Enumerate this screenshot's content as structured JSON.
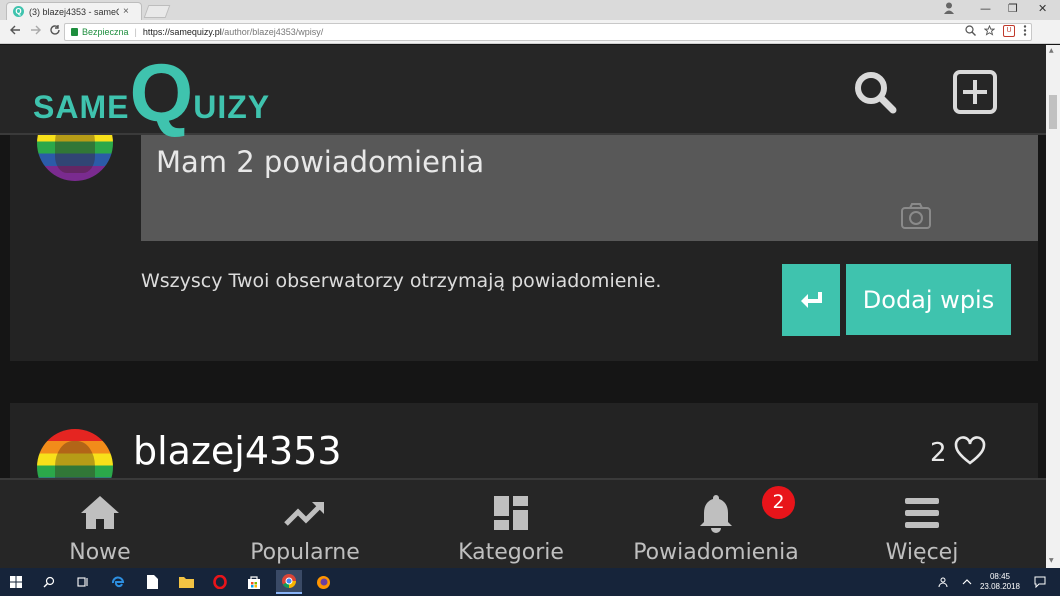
{
  "browser": {
    "tab_title": "(3) blazej4353 - sameQui",
    "tab_close": "×",
    "favicon_letter": "Q",
    "secure_label": "Bezpieczna",
    "url_host": "https://samequizy.pl",
    "url_path": "/author/blazej4353/wpisy/",
    "window_controls": [
      "—",
      "❐",
      "✕"
    ]
  },
  "header": {
    "logo_same": "same",
    "logo_q": "Q",
    "logo_uizy": "uizy",
    "search_icon": "search-icon",
    "add_icon": "plus-square-icon"
  },
  "compose": {
    "input_text": "Mam 2 powiadomienia",
    "notice": "Wszyscy Twoi obserwatorzy otrzymają powiadomienie.",
    "enter_icon": "enter-arrow-icon",
    "submit_label": "Dodaj wpis"
  },
  "post": {
    "author": "blazej4353",
    "likes": "2"
  },
  "bottom_nav": [
    {
      "label": "Nowe",
      "icon": "home-icon"
    },
    {
      "label": "Popularne",
      "icon": "trending-icon"
    },
    {
      "label": "Kategorie",
      "icon": "grid-icon"
    },
    {
      "label": "Powiadomienia",
      "icon": "bell-icon",
      "badge": "2"
    },
    {
      "label": "Więcej",
      "icon": "menu-icon"
    }
  ],
  "taskbar": {
    "time": "08:45",
    "date": "23.08.2018"
  },
  "colors": {
    "accent": "#3fc3ae",
    "badge": "#e8141a",
    "background": "#151515",
    "card": "#232323"
  }
}
